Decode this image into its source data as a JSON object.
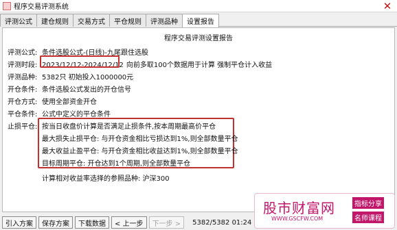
{
  "window": {
    "title": "程序交易评测系统",
    "close_glyph": "✕"
  },
  "tabs": [
    "评测公式",
    "建仓规则",
    "交易方式",
    "平仓规则",
    "评测品种",
    "设置报告"
  ],
  "report": {
    "title": "程序交易评测设置报告",
    "rows": [
      {
        "label": "评测公式:",
        "value": "条件选股公式-(日线)-九尾跟住选股"
      },
      {
        "label": "评测时段:",
        "value": "2023/12/12-2024/12/12",
        "value_tail": "向前多取100个数据用于计算 强制平仓计入收益"
      },
      {
        "label": "评测品种:",
        "value": "5382只 初始投入1000000元"
      },
      {
        "label": "开仓条件:",
        "value": "条件选股公式发出的开仓信号"
      },
      {
        "label": "开仓方式:",
        "value": "使用全部资金开仓"
      },
      {
        "label": "平仓条件:",
        "value": "公式中定义的平仓条件"
      }
    ],
    "stop_label": "止损平仓:",
    "stop_lines": [
      "按当日收盘价计算是否满足止损条件,按本周期最高价平仓",
      "最大损失止损平仓: 与开仓资金相比亏损达到1%,则全部数量平仓",
      "最大收益止盈平仓: 与开仓资金相比收益达到1%,则全部数量平仓",
      "目标周期平仓: 开仓达到1个周期,则全部数量平仓"
    ],
    "footer_line": "计算相对收益率选择的参照品种: 沪深300",
    "highlight_color": "#c0312f"
  },
  "statusbar": {
    "buttons": [
      "引入方案",
      "保存方案",
      "下载数据",
      "< 上一步",
      "下一步 >"
    ],
    "counter": "5382/5382 01:24"
  },
  "watermark": {
    "main": "股市财富网",
    "url": "WWW.GSCFW.COM",
    "tag1": "指标分享",
    "tag2": "名师课程"
  }
}
